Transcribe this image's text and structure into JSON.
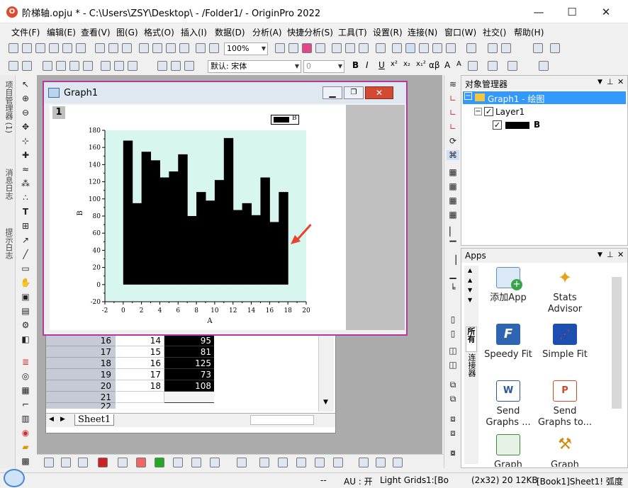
{
  "window": {
    "title": "阶梯轴.opju * - C:\\Users\\ZSY\\Desktop\\ - /Folder1/ - OriginPro 2022",
    "minimize": "—",
    "maximize": "☐",
    "close": "✕"
  },
  "menu": [
    "文件(F)",
    "编辑(E)",
    "查看(V)",
    "图(G)",
    "格式(O)",
    "插入(I)",
    "数据(D)",
    "分析(A)",
    "快捷分析(S)",
    "工具(T)",
    "设置(R)",
    "连接(N)",
    "窗口(W)",
    "社交()",
    "帮助(H)"
  ],
  "toolbar": {
    "zoom": "100%",
    "font": "默认: 宋体",
    "font_size": "0",
    "format_labels": [
      "B",
      "I",
      "U",
      "x²",
      "x₂",
      "x₁²",
      "αβ",
      "A",
      "A"
    ]
  },
  "left_tabs": [
    "项目管理器 (1)",
    "消息日志",
    "提示日志"
  ],
  "worksheet": {
    "rows": [
      {
        "n": "16",
        "a": "14",
        "b": "95"
      },
      {
        "n": "17",
        "a": "15",
        "b": "81"
      },
      {
        "n": "18",
        "a": "16",
        "b": "125"
      },
      {
        "n": "19",
        "a": "17",
        "b": "73"
      },
      {
        "n": "20",
        "a": "18",
        "b": "108"
      },
      {
        "n": "21",
        "a": "",
        "b": ""
      },
      {
        "n": "22",
        "a": "",
        "b": ""
      }
    ],
    "sheet_tab": "Sheet1"
  },
  "graph_window": {
    "title": "Graph1",
    "layer_number": "1",
    "legend": "B"
  },
  "chart_data": {
    "type": "bar",
    "xlabel": "A",
    "ylabel": "B",
    "xlim": [
      -2,
      20
    ],
    "ylim": [
      -20,
      180
    ],
    "x_ticks": [
      "-2",
      "0",
      "2",
      "4",
      "6",
      "8",
      "10",
      "12",
      "14",
      "16",
      "18",
      "20"
    ],
    "y_ticks": [
      "-20",
      "0",
      "20",
      "40",
      "60",
      "80",
      "100",
      "120",
      "140",
      "160",
      "180"
    ],
    "series": [
      {
        "name": "B",
        "x": [
          0,
          1,
          2,
          3,
          4,
          5,
          6,
          7,
          8,
          9,
          10,
          11,
          12,
          13,
          14,
          15,
          16,
          17,
          18
        ],
        "values": [
          168,
          95,
          155,
          145,
          125,
          132,
          152,
          80,
          108,
          98,
          122,
          171,
          87,
          95,
          81,
          125,
          73,
          108,
          108
        ]
      }
    ],
    "bar_color": "#000000",
    "plot_background": "#d7f7ee",
    "annotation_color": "#e8432d"
  },
  "object_manager": {
    "title": "对象管理器",
    "graph": "Graph1 - 绘图",
    "layer": "Layer1",
    "plot": "B"
  },
  "apps": {
    "title": "Apps",
    "side_tabs": [
      "所有",
      "连接器"
    ],
    "items": [
      {
        "label": "添加App",
        "icon": "add-app-icon"
      },
      {
        "label": "Stats Advisor",
        "icon": "wand-icon"
      },
      {
        "label": "Speedy Fit",
        "icon": "speedy-fit-icon"
      },
      {
        "label": "Simple Fit",
        "icon": "simple-fit-icon"
      },
      {
        "label": "Send Graphs ...",
        "icon": "word-icon"
      },
      {
        "label": "Send Graphs to...",
        "icon": "ppt-icon"
      },
      {
        "label": "Graph",
        "icon": "graph-app-icon"
      },
      {
        "label": "Graph",
        "icon": "tool-icon"
      }
    ]
  },
  "status": {
    "au": "AU : 开",
    "light_grids": "Light Grids",
    "page": "1:[Bo",
    "info": "(2x32) 20 12KB",
    "location": "[Book1]Sheet1! 弧度"
  }
}
